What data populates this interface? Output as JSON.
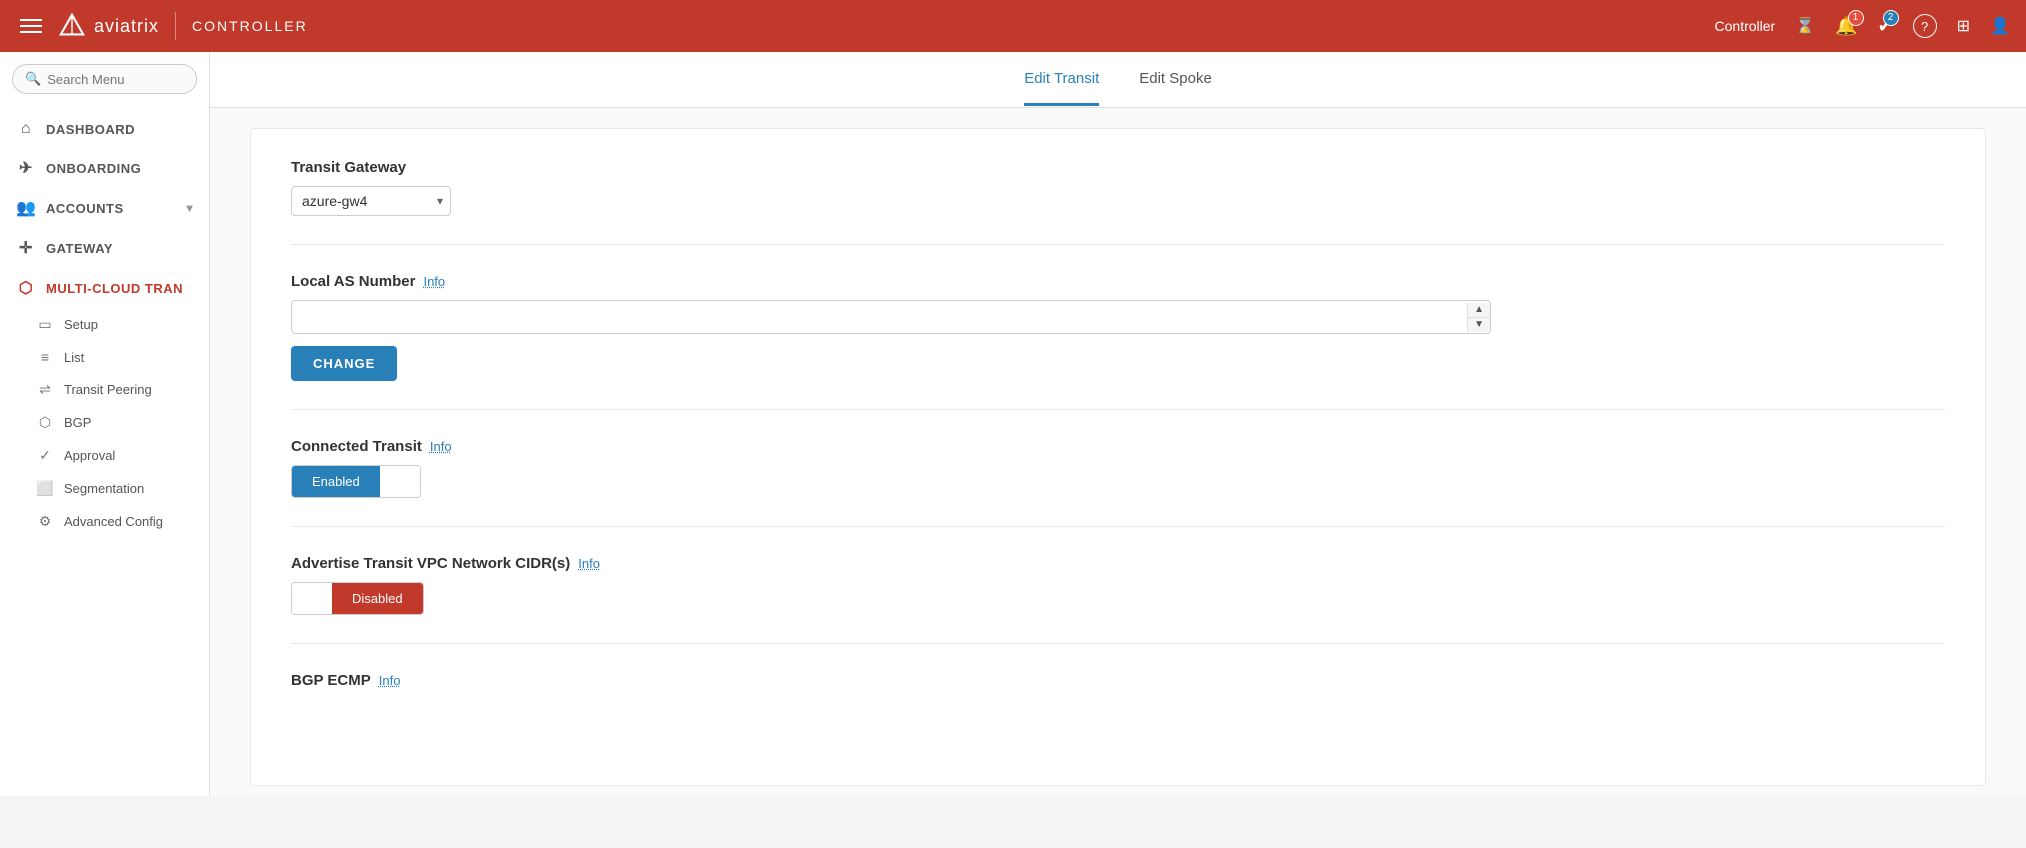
{
  "topnav": {
    "hamburger_label": "Menu",
    "logo_text": "aviatrix",
    "divider": "|",
    "controller_label": "Controller",
    "username": "Controller",
    "notification_count": "1",
    "task_count": "2",
    "icons": {
      "hourglass": "⌛",
      "bell": "🔔",
      "check": "✔",
      "question": "?",
      "grid": "⊞",
      "user": "👤"
    }
  },
  "sidebar": {
    "search_placeholder": "Search Menu",
    "items": [
      {
        "id": "dashboard",
        "label": "DASHBOARD",
        "icon": "⌂"
      },
      {
        "id": "onboarding",
        "label": "ONBOARDING",
        "icon": "✈"
      },
      {
        "id": "accounts",
        "label": "ACCOUNTS",
        "icon": "👥",
        "has_arrow": true
      },
      {
        "id": "gateway",
        "label": "GATEWAY",
        "icon": "+"
      },
      {
        "id": "multi-cloud-tran",
        "label": "MULTI-CLOUD TRAN",
        "icon": "⬡"
      }
    ],
    "sub_items": [
      {
        "id": "setup",
        "label": "Setup",
        "icon": "▭"
      },
      {
        "id": "list",
        "label": "List",
        "icon": "≡"
      },
      {
        "id": "transit-peering",
        "label": "Transit Peering",
        "icon": "⇌"
      },
      {
        "id": "bgp",
        "label": "BGP",
        "icon": "⬡"
      },
      {
        "id": "approval",
        "label": "Approval",
        "icon": "✓"
      },
      {
        "id": "segmentation",
        "label": "Segmentation",
        "icon": "⬜"
      },
      {
        "id": "advanced-config",
        "label": "Advanced Config",
        "icon": "⚙"
      }
    ]
  },
  "tabs": [
    {
      "id": "edit-transit",
      "label": "Edit Transit",
      "active": true
    },
    {
      "id": "edit-spoke",
      "label": "Edit Spoke",
      "active": false
    }
  ],
  "form": {
    "transit_gateway": {
      "label": "Transit Gateway",
      "value": "azure-gw4",
      "options": [
        "azure-gw4"
      ]
    },
    "local_as_number": {
      "label": "Local AS Number",
      "info_label": "Info",
      "value": "",
      "placeholder": ""
    },
    "change_button": "CHANGE",
    "connected_transit": {
      "label": "Connected Transit",
      "info_label": "Info",
      "enabled_label": "Enabled",
      "disabled_label": ""
    },
    "advertise_transit_vpc": {
      "label": "Advertise Transit VPC Network CIDR(s)",
      "info_label": "Info",
      "enabled_label": "",
      "disabled_label": "Disabled"
    },
    "bgp_ecmp": {
      "label": "BGP ECMP",
      "info_label": "Info"
    }
  }
}
